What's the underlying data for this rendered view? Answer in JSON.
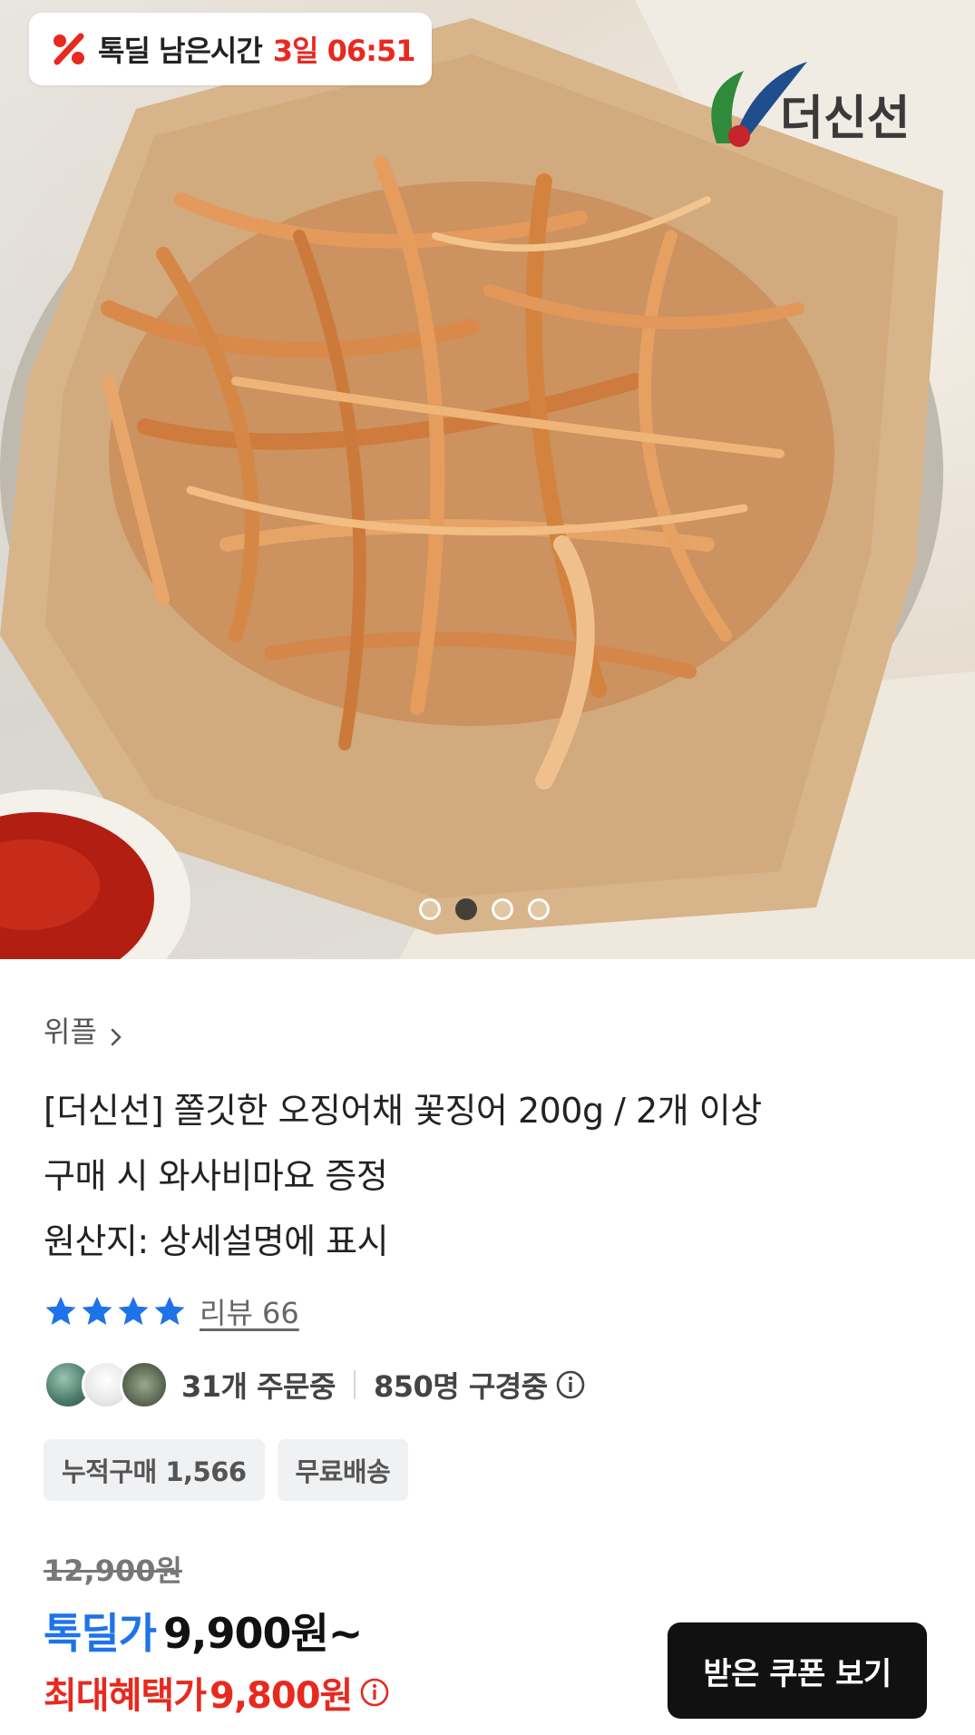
{
  "timer": {
    "label": "톡딜 남은시간",
    "time": "3일 06:51"
  },
  "brand": {
    "name": "더신선"
  },
  "carousel": {
    "total": 4,
    "active": 2
  },
  "breadcrumb": {
    "label": "위플"
  },
  "product": {
    "title_line1": "[더신선] 쫄깃한 오징어채 꽃징어 200g / 2개 이상",
    "title_line2": "구매 시 와사비마요 증정",
    "title_line3": "원산지: 상세설명에 표시"
  },
  "reviews": {
    "rating_stars": 4,
    "label": "리뷰 66"
  },
  "orders": {
    "ordering": "31개 주문중",
    "watching": "850명 구경중"
  },
  "badges": [
    "누적구매 1,566",
    "무료배송"
  ],
  "price": {
    "original": "12,900원",
    "deal_label": "톡딜가",
    "deal_price": "9,900원~",
    "max_label": "최대혜택가",
    "max_price": "9,800원"
  },
  "coupon_button": {
    "label": "받은 쿠폰 보기"
  },
  "colors": {
    "deal_blue": "#1e73e8",
    "accent_red": "#e8291f",
    "button_black": "#111111",
    "star_blue": "#1e73e8"
  },
  "icons": [
    "percent-icon",
    "chevron-right-icon",
    "star-icon",
    "info-icon"
  ]
}
